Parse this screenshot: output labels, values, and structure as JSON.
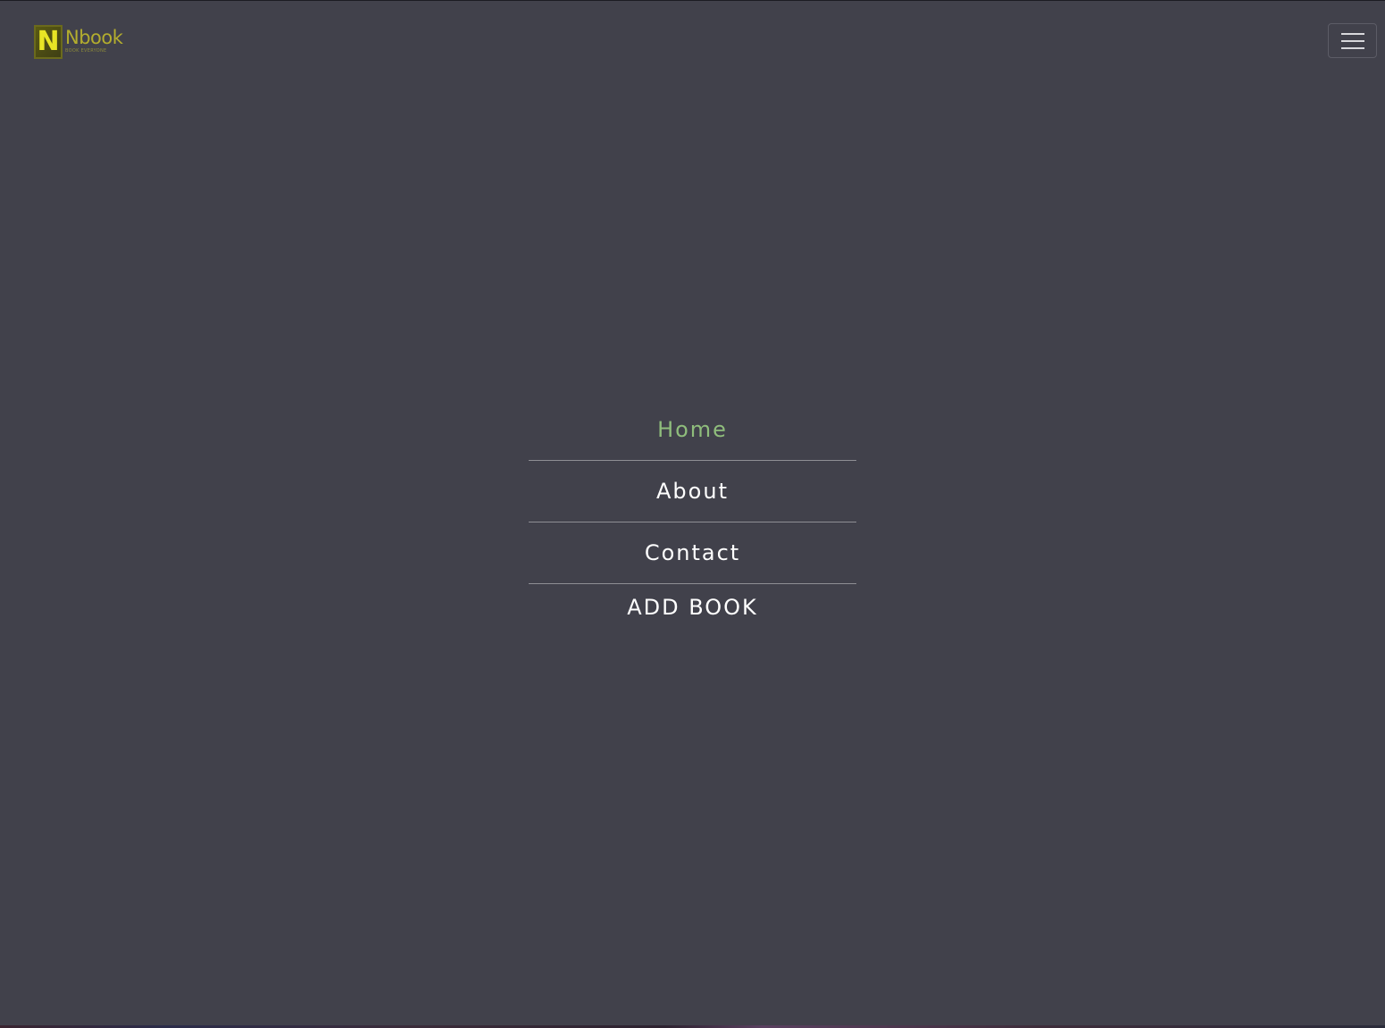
{
  "brand": {
    "mark_letter": "N",
    "name": "Nbook",
    "tagline": "BOOK EVERYONE"
  },
  "navbar": {
    "toggle_icon": "hamburger-icon"
  },
  "menu": {
    "items": [
      {
        "label": "Home",
        "active": true
      },
      {
        "label": "About",
        "active": false
      },
      {
        "label": "Contact",
        "active": false
      },
      {
        "label": "ADD BOOK",
        "active": false
      }
    ]
  },
  "colors": {
    "background": "#41414b",
    "active_link": "#8fbd7c",
    "link": "#ffffff",
    "brand_gold": "#b3ad2e"
  }
}
